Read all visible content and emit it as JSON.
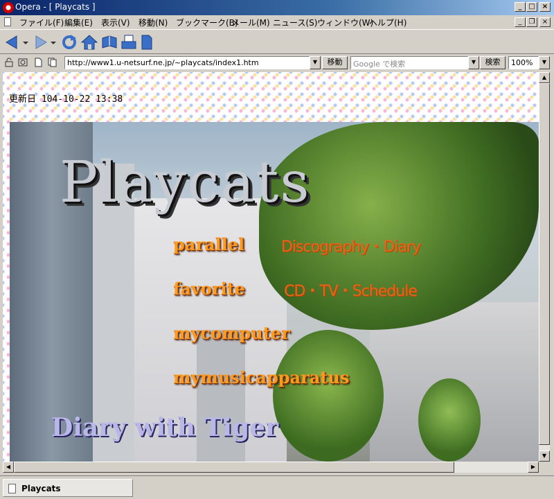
{
  "window": {
    "title": "Opera - [ Playcats ]"
  },
  "menubar": {
    "items": [
      "ファイル(F)",
      "編集(E)",
      "表示(V)",
      "移動(N)",
      "ブックマーク(B)",
      "メール(M)",
      "ニュース(S)",
      "ウィンドウ(W)",
      "ヘルプ(H)"
    ]
  },
  "addressbar": {
    "url": "http://www1.u-netsurf.ne.jp/~playcats/index1.htm",
    "go_label": "移動",
    "search_placeholder": "Google で検索",
    "search_label": "検索",
    "zoom": "100%"
  },
  "page": {
    "updated": "更新日 104-10-22 13:38",
    "brand": "Playcats",
    "links": [
      {
        "label": "parallel",
        "subtitle": "Discography・Diary"
      },
      {
        "label": "favorite",
        "subtitle": "CD・TV・Schedule"
      },
      {
        "label": "mycomputer",
        "subtitle": ""
      },
      {
        "label": "mymusicapparatus",
        "subtitle": ""
      }
    ],
    "diary": "Diary with Tiger"
  },
  "tabs": [
    {
      "label": "Playcats"
    }
  ],
  "colors": {
    "titlebar": "#0a246a",
    "link": "#ff9a1f",
    "subtitle": "#e86418"
  }
}
